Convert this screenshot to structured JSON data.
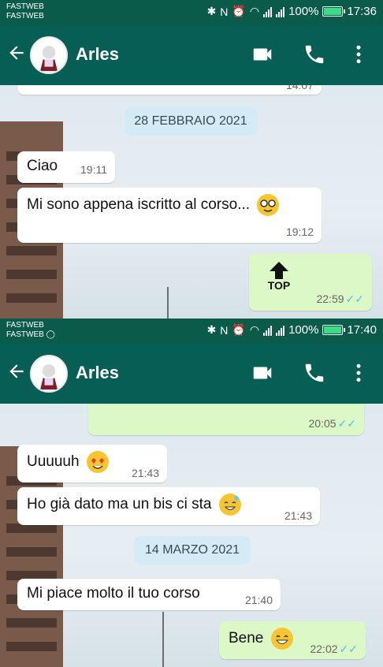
{
  "screen1": {
    "carrier_lines": [
      "FASTWEB",
      "FASTWEB"
    ],
    "status": {
      "battery": "100%",
      "time": "17:36"
    },
    "contact": "Arles",
    "date_chip": "28 FEBBRAIO 2021",
    "partial_time": "14:07",
    "messages": [
      {
        "text": "Ciao",
        "time": "19:11"
      },
      {
        "text": "Mi sono appena iscritto al corso...",
        "time": "19:12"
      },
      {
        "sticker": "TOP",
        "time": "22:59"
      }
    ]
  },
  "screen2": {
    "carrier_lines": [
      "FASTWEB",
      "FASTWEB"
    ],
    "status": {
      "battery": "100%",
      "time": "17:40"
    },
    "contact": "Arles",
    "partial_time": "20:05",
    "date_chip": "14 MARZO 2021",
    "messages": [
      {
        "text": "Uuuuuh",
        "time": "21:43"
      },
      {
        "text": "Ho già dato ma un bis ci sta",
        "time": "21:43"
      },
      {
        "text": "Mi piace molto il tuo corso",
        "time": "21:40"
      },
      {
        "text": "Bene",
        "time": "22:02"
      }
    ]
  },
  "icons": [
    "back-arrow-icon",
    "video-call-icon",
    "phone-icon",
    "more-vert-icon",
    "bluetooth-icon",
    "nfc-icon",
    "alarm-icon",
    "wifi-icon",
    "whatsapp-icon",
    "battery-icon",
    "double-check-icon"
  ],
  "colors": {
    "header": "#075e54",
    "statusbar": "#0a5b49",
    "outgoing": "#dcf8c6",
    "incoming": "#ffffff",
    "date_chip": "#d4eaf4",
    "read_ticks": "#4fc3f7"
  }
}
